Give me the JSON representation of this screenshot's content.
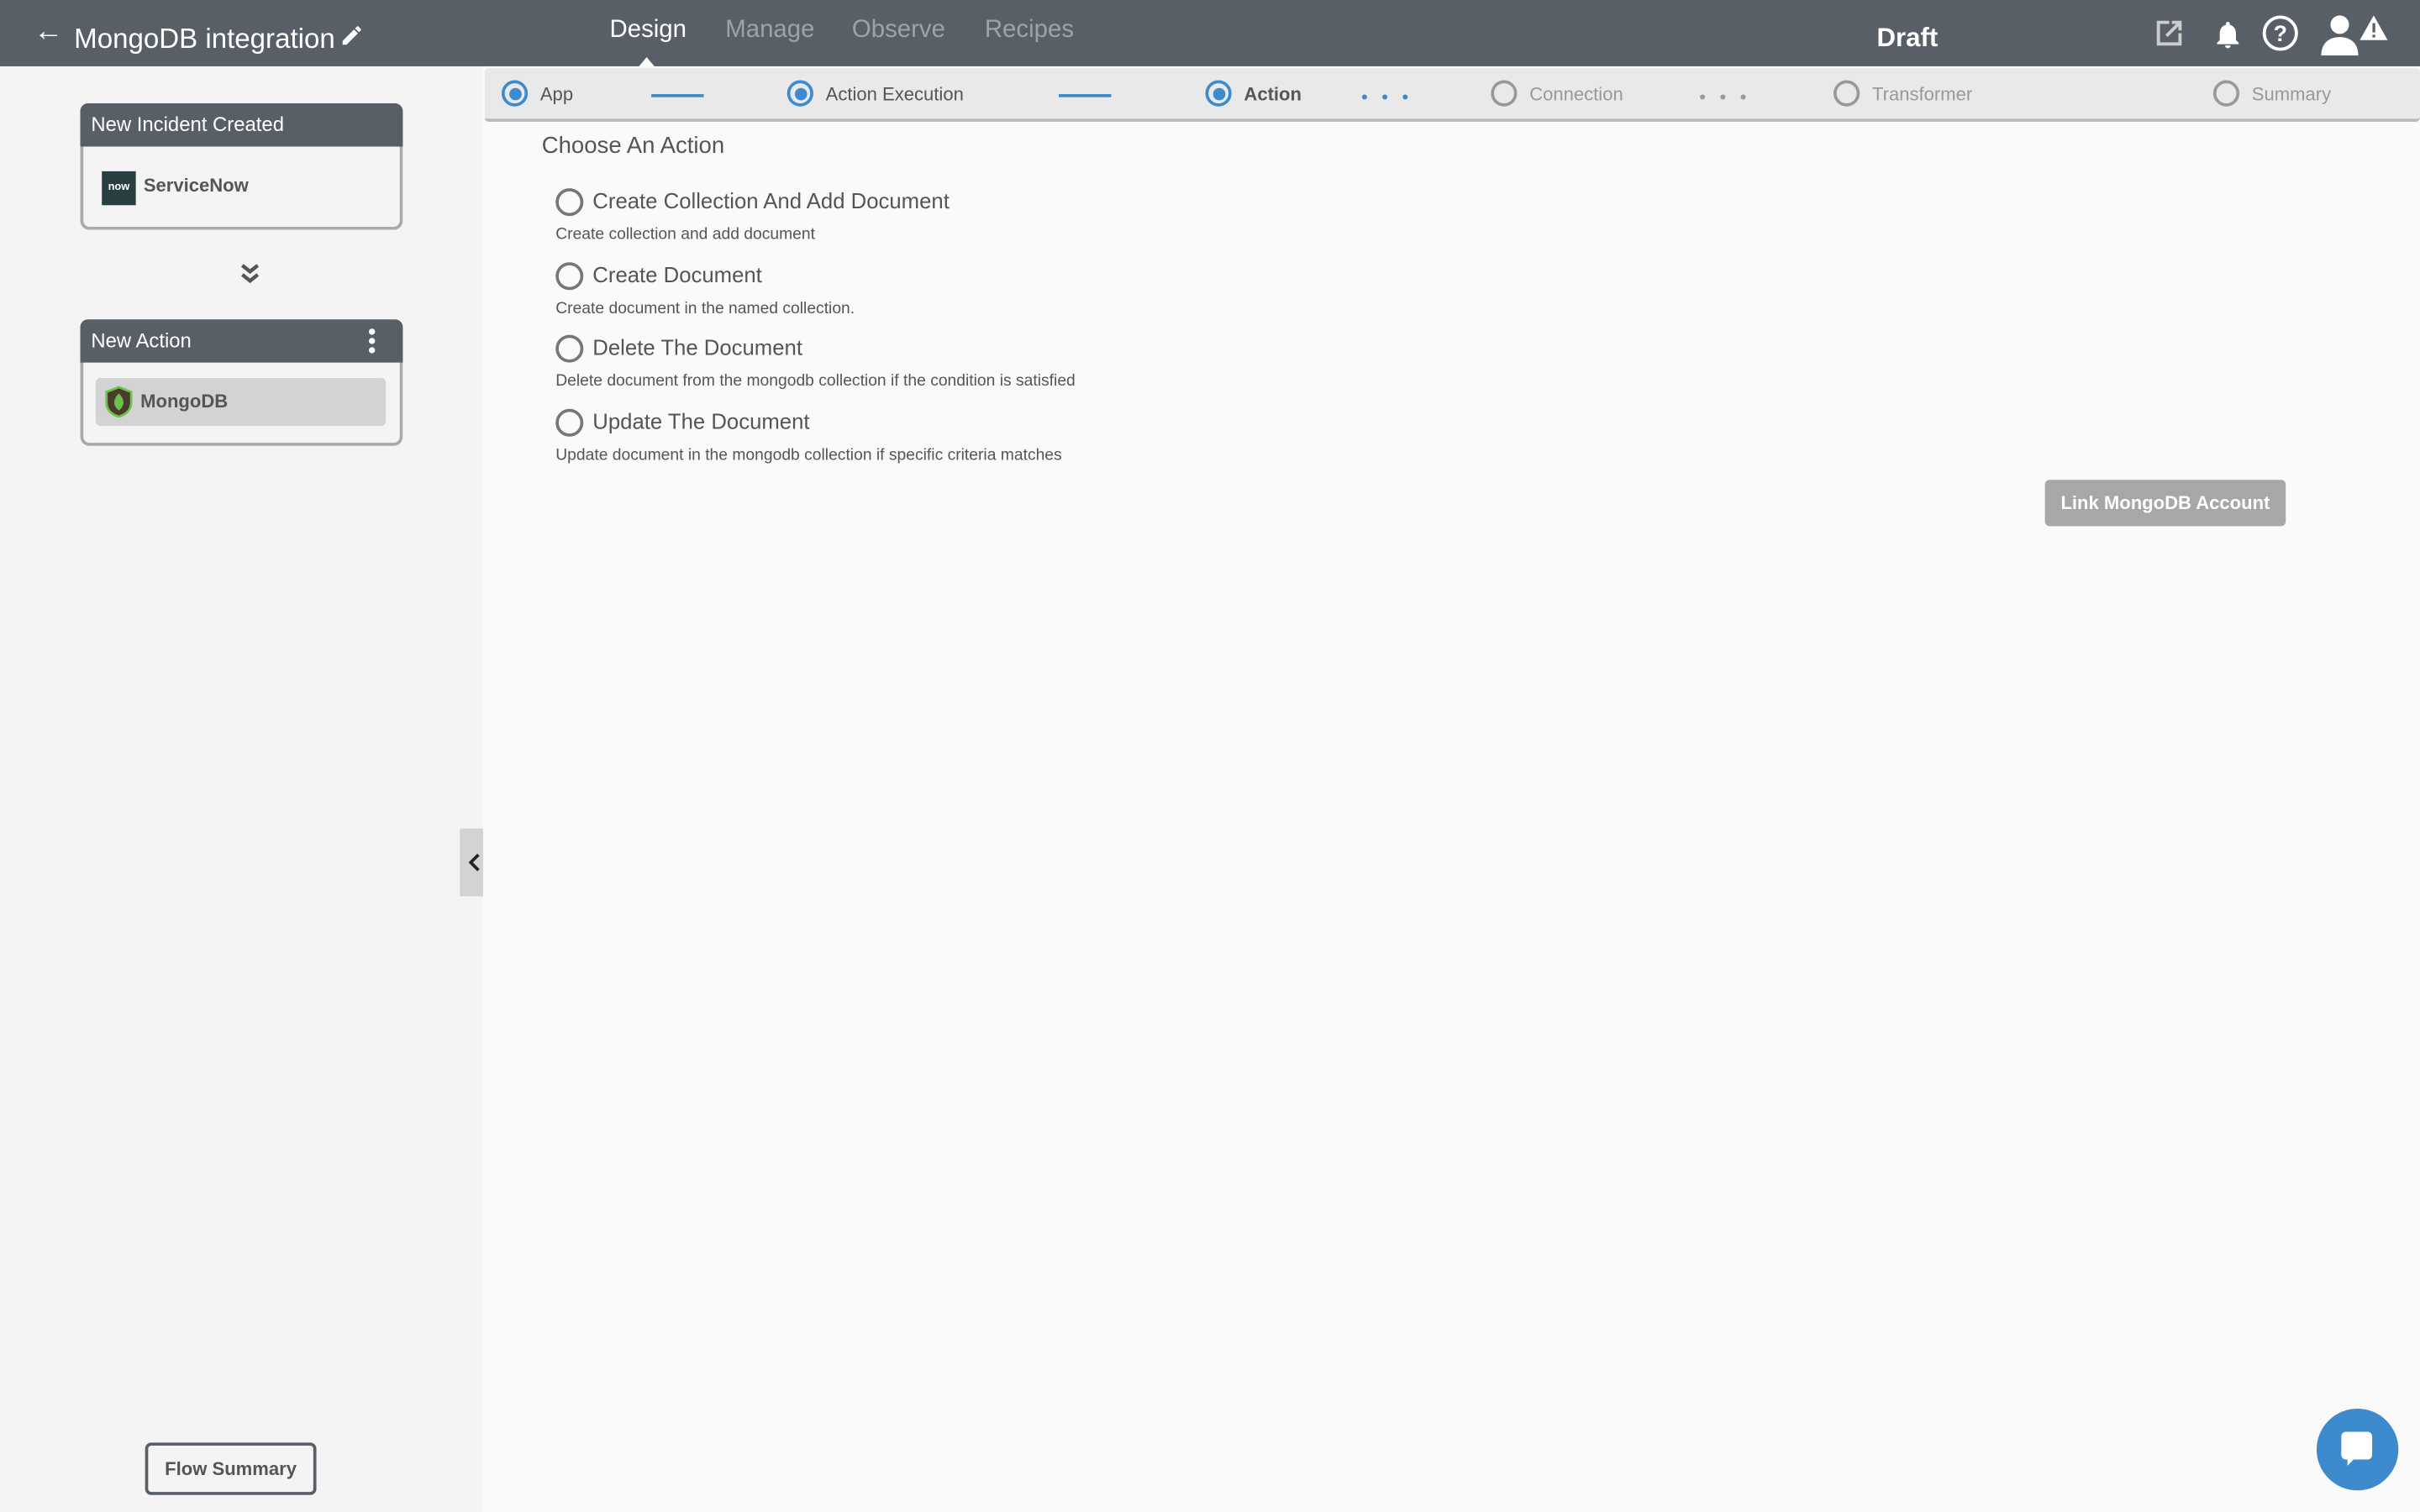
{
  "header": {
    "title": "MongoDB integration",
    "tabs": [
      {
        "label": "Design",
        "active": true
      },
      {
        "label": "Manage"
      },
      {
        "label": "Observe"
      },
      {
        "label": "Recipes"
      }
    ],
    "status": "Draft",
    "icons": [
      "back-arrow-icon",
      "pencil-icon",
      "external-link-icon",
      "bell-icon",
      "help-icon",
      "user-warning-icon"
    ]
  },
  "sidebar": {
    "trigger_card": {
      "title": "New Incident Created",
      "app": "ServiceNow",
      "logo_text": "now"
    },
    "action_card": {
      "title": "New Action",
      "app": "MongoDB"
    },
    "flow_summary_label": "Flow Summary"
  },
  "stepper": {
    "steps": [
      {
        "label": "App",
        "state": "done"
      },
      {
        "label": "Action Execution",
        "state": "done"
      },
      {
        "label": "Action",
        "state": "current"
      },
      {
        "label": "Connection",
        "state": "pending"
      },
      {
        "label": "Transformer",
        "state": "pending"
      },
      {
        "label": "Summary",
        "state": "pending"
      }
    ]
  },
  "main": {
    "title": "Choose An Action",
    "options": [
      {
        "label": "Create Collection And Add Document",
        "description": "Create collection and add document"
      },
      {
        "label": "Create Document",
        "description": "Create document in the named collection."
      },
      {
        "label": "Delete The Document",
        "description": "Delete document from the mongodb collection if the condition is satisfied"
      },
      {
        "label": "Update The Document",
        "description": "Update document in the mongodb collection if specific criteria matches"
      }
    ],
    "link_button": "Link MongoDB Account"
  },
  "colors": {
    "header": "#585f66",
    "accent": "#3d8bcd",
    "button_disabled": "#a6a7a9"
  }
}
